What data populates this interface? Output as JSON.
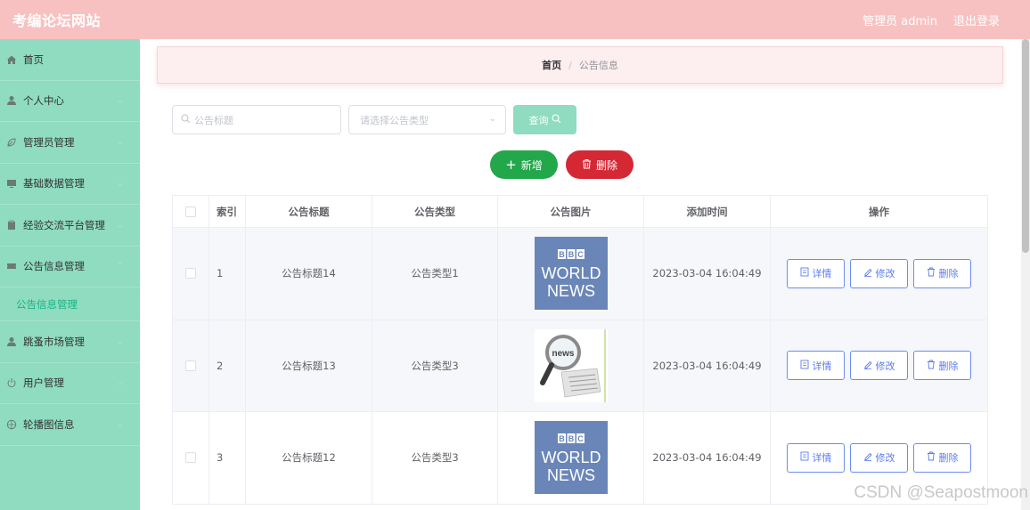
{
  "header": {
    "site_title": "考编论坛网站",
    "user_label": "管理员 admin",
    "logout_label": "退出登录"
  },
  "sidebar": {
    "items": [
      {
        "label": "首页",
        "icon": "home-icon",
        "expandable": false
      },
      {
        "label": "个人中心",
        "icon": "user-icon",
        "expandable": true
      },
      {
        "label": "管理员管理",
        "icon": "leaf-icon",
        "expandable": true
      },
      {
        "label": "基础数据管理",
        "icon": "monitor-icon",
        "expandable": true
      },
      {
        "label": "经验交流平台管理",
        "icon": "clipboard-icon",
        "expandable": true
      },
      {
        "label": "公告信息管理",
        "icon": "tickets-icon",
        "expandable": true,
        "open": true
      },
      {
        "label": "跳蚤市场管理",
        "icon": "user-icon",
        "expandable": true
      },
      {
        "label": "用户管理",
        "icon": "power-icon",
        "expandable": true
      },
      {
        "label": "轮播图信息",
        "icon": "basketball-icon",
        "expandable": true
      }
    ],
    "sub_items": [
      {
        "label": "公告信息管理"
      }
    ]
  },
  "breadcrumb": {
    "home": "首页",
    "separator": "/",
    "current": "公告信息"
  },
  "search": {
    "title_placeholder": "公告标题",
    "type_placeholder": "请选择公告类型",
    "query_label": "查询"
  },
  "actions": {
    "add_label": "新增",
    "delete_label": "删除"
  },
  "table": {
    "headers": [
      "索引",
      "公告标题",
      "公告类型",
      "公告图片",
      "添加时间",
      "操作"
    ],
    "rows": [
      {
        "index": "1",
        "title": "公告标题14",
        "type": "公告类型1",
        "image": "bbc-world-news",
        "time": "2023-03-04 16:04:49"
      },
      {
        "index": "2",
        "title": "公告标题13",
        "type": "公告类型3",
        "image": "news-magnifier",
        "time": "2023-03-04 16:04:49"
      },
      {
        "index": "3",
        "title": "公告标题12",
        "type": "公告类型3",
        "image": "bbc-world-news",
        "time": "2023-03-04 16:04:49"
      }
    ],
    "op_labels": {
      "detail": "详情",
      "edit": "修改",
      "delete": "删除"
    }
  },
  "thumb_text": {
    "bbc": "BBC",
    "world": "WORLD",
    "news": "NEWS",
    "news_small": "news"
  },
  "watermark": "CSDN @Seapostmoon",
  "colors": {
    "header_bg": "#f8c1c1",
    "sidebar_bg": "#8fdcc0",
    "active_sub": "#17b384",
    "add_button": "#22a74a",
    "delete_button": "#d42835",
    "op_border": "#6b8df0"
  }
}
